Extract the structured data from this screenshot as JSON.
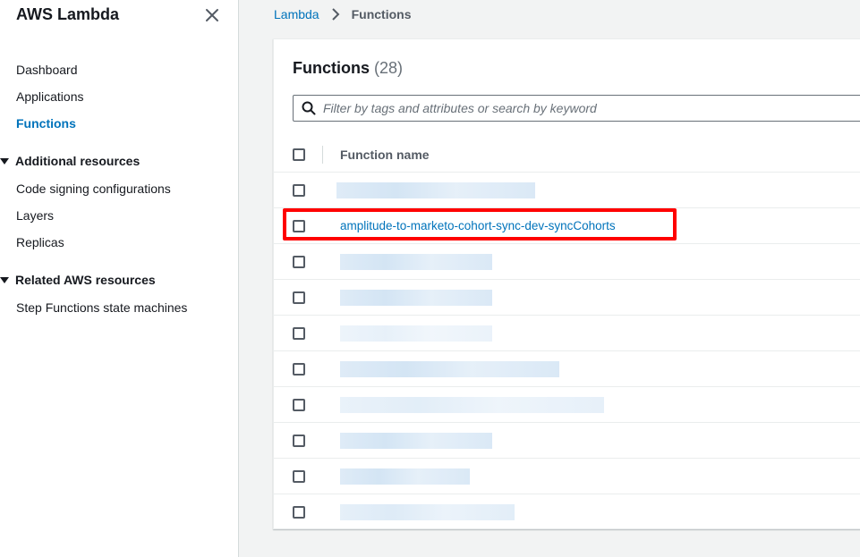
{
  "sidebar": {
    "title": "AWS Lambda",
    "close_icon": "close-icon",
    "items": [
      {
        "label": "Dashboard"
      },
      {
        "label": "Applications"
      },
      {
        "label": "Functions",
        "active": true
      }
    ],
    "sections": [
      {
        "label": "Additional resources",
        "items": [
          {
            "label": "Code signing configurations"
          },
          {
            "label": "Layers"
          },
          {
            "label": "Replicas"
          }
        ]
      },
      {
        "label": "Related AWS resources",
        "items": [
          {
            "label": "Step Functions state machines"
          }
        ]
      }
    ]
  },
  "breadcrumb": {
    "items": [
      {
        "label": "Lambda"
      },
      {
        "label": "Functions"
      }
    ]
  },
  "panel": {
    "title": "Functions",
    "count": "(28)",
    "search_placeholder": "Filter by tags and attributes or search by keyword",
    "column_header": "Function name",
    "rows": [
      {
        "name": "",
        "redacted": true
      },
      {
        "name": "amplitude-to-marketo-cohort-sync-dev-syncCohorts",
        "redacted": false,
        "highlighted": true
      },
      {
        "name": "",
        "redacted": true
      },
      {
        "name": "",
        "redacted": true
      },
      {
        "name": "",
        "redacted": true
      },
      {
        "name": "",
        "redacted": true
      },
      {
        "name": "",
        "redacted": true
      },
      {
        "name": "",
        "redacted": true
      },
      {
        "name": "",
        "redacted": true
      },
      {
        "name": "",
        "redacted": true
      }
    ]
  },
  "colors": {
    "link": "#0073bb",
    "highlight": "#ff0000"
  }
}
